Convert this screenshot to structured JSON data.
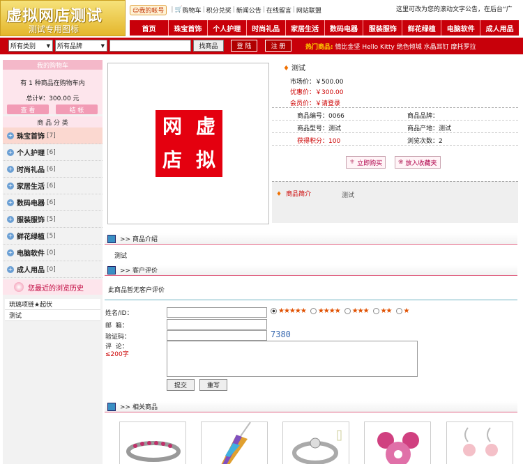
{
  "header": {
    "logo_title": "虚拟网店测试",
    "logo_subtitle": "测试专用图标",
    "account_link": "我的帐号",
    "links": [
      "购物车",
      "积分兑奖",
      "新闻公告",
      "在线留言",
      "网站联盟"
    ],
    "marquee": "这里可改为您的滚动文字公告，在后台“广"
  },
  "nav": [
    "首页",
    "珠宝首饰",
    "个人护理",
    "时尚礼品",
    "家居生活",
    "数码电器",
    "服装服饰",
    "鲜花绿植",
    "电脑软件",
    "成人用品"
  ],
  "search": {
    "category_select": "所有类别",
    "brand_select": "所有品牌",
    "input_value": "",
    "search_button": "找商品",
    "login_button": "登 陆",
    "register_button": "注 册",
    "hot_label": "热门商品:",
    "hot_items": [
      "情比金坚",
      "Hello Kitty",
      "绝色倾城",
      "水晶耳钉",
      "摩托罗拉"
    ]
  },
  "sidebar": {
    "cart_title": "我的购物车",
    "cart_line1": "有 1 种商品在购物车内",
    "cart_line2": "总计¥：300.00 元",
    "view_button": "查 看",
    "checkout_button": "结 帐",
    "category_title": "商 品 分 类",
    "categories": [
      {
        "name": "珠宝首饰",
        "count": "[7]"
      },
      {
        "name": "个人护理",
        "count": "[6]"
      },
      {
        "name": "时尚礼品",
        "count": "[6]"
      },
      {
        "name": "家居生活",
        "count": "[6]"
      },
      {
        "name": "数码电器",
        "count": "[6]"
      },
      {
        "name": "服装服饰",
        "count": "[5]"
      },
      {
        "name": "鲜花绿植",
        "count": "[5]"
      },
      {
        "name": "电脑软件",
        "count": "[0]"
      },
      {
        "name": "成人用品",
        "count": "[0]"
      }
    ],
    "history_title": "您最近的浏览历史",
    "history": [
      "琉璃项链★起伏",
      "测试"
    ]
  },
  "product": {
    "image_text": [
      "网",
      "虚",
      "店",
      "拟"
    ],
    "title": "测试",
    "market_price": "市场价：￥500.00",
    "sale_price": "优惠价：￥300.00",
    "member_price": "会员价：￥请登录",
    "attrs": [
      [
        "商品编号：0066",
        "商品品牌："
      ],
      [
        "商品型号：测试",
        "商品产地：测试"
      ],
      [
        "获得积分：100",
        "浏览次数：2"
      ]
    ],
    "buy_button": "立即购买",
    "fav_button": "放入收藏夹",
    "brief_label": "商品简介",
    "brief_value": "测试"
  },
  "sections": {
    "intro_title": ">> 商品介绍",
    "intro_text": "测试",
    "review_title": ">> 客户评价",
    "review_text": "此商品暂无客户评价",
    "related_title": ">> 相关商品"
  },
  "form": {
    "name_label": "姓名/ID：",
    "email_label": "邮  箱：",
    "code_label": "验证码：",
    "comment_label": "评  论：",
    "comment_limit": "≤200字",
    "captcha": "7380",
    "ratings": [
      "★★★★★",
      "★★★★",
      "★★★",
      "★★",
      "★"
    ],
    "submit_button": "提交",
    "reset_button": "重写"
  },
  "colors": {
    "brand_red": "#c8000a",
    "pink": "#f4b8c9",
    "gold": "#e4b62c"
  }
}
